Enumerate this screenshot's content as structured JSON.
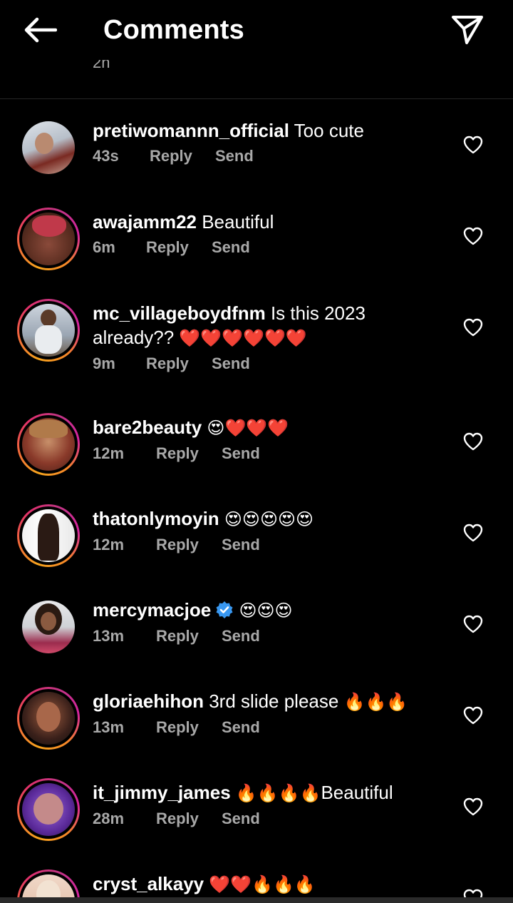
{
  "header": {
    "title": "Comments",
    "back_icon": "arrow-left-icon",
    "share_icon": "paper-plane-icon"
  },
  "caption": {
    "time": "2h"
  },
  "actions": {
    "reply": "Reply",
    "send": "Send"
  },
  "comments": [
    {
      "username": "pretiwomannn_official",
      "text": " Too cute",
      "emoji": "",
      "time": "43s",
      "story_ring": false,
      "verified": false
    },
    {
      "username": "awajamm22",
      "text": " Beautiful",
      "emoji": "",
      "time": "6m",
      "story_ring": true,
      "verified": false
    },
    {
      "username": "mc_villageboydfnm",
      "text": " Is this 2023 already?? ",
      "emoji": "❤️❤️❤️❤️❤️❤️",
      "time": "9m",
      "story_ring": true,
      "verified": false
    },
    {
      "username": "bare2beauty",
      "text": " ",
      "emoji": "😍❤️❤️❤️",
      "time": "12m",
      "story_ring": true,
      "verified": false
    },
    {
      "username": "thatonlymoyin",
      "text": " ",
      "emoji": "😍😍😍😍😍",
      "time": "12m",
      "story_ring": true,
      "verified": false
    },
    {
      "username": "mercymacjoe",
      "text": " ",
      "emoji": "😍😍😍",
      "time": "13m",
      "story_ring": false,
      "verified": true
    },
    {
      "username": "gloriaehihon",
      "text": " 3rd slide please ",
      "emoji": "🔥🔥🔥",
      "time": "13m",
      "story_ring": true,
      "verified": false
    },
    {
      "username": "it_jimmy_james",
      "text": " ",
      "emoji": "🔥🔥🔥🔥",
      "text_after": "Beautiful",
      "time": "28m",
      "story_ring": true,
      "verified": false
    },
    {
      "username": "cryst_alkayy",
      "text": " ",
      "emoji": "❤️❤️🔥🔥🔥",
      "time": "",
      "story_ring": true,
      "verified": false
    }
  ],
  "colors": {
    "background": "#000000",
    "meta_text": "#a8a8a8",
    "verified_blue": "#3897f0",
    "divider": "#262626"
  }
}
